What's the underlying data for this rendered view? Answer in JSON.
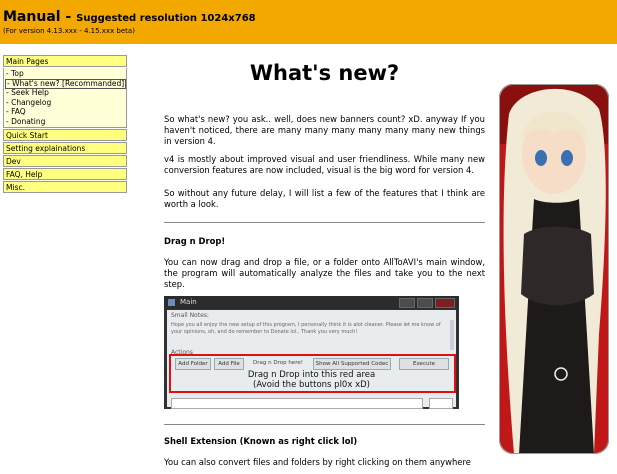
{
  "header": {
    "title": "Manual - ",
    "subtitle": "Suggested resolution 1024x768",
    "version": "(For version 4.13.xxx - 4.15.xxx beta)"
  },
  "sidebar": {
    "main_pages_label": "Main Pages",
    "items": [
      {
        "label": "- Top"
      },
      {
        "label": "- What's new? [Recommanded]"
      },
      {
        "label": "- Seek Help"
      },
      {
        "label": "- Changelog"
      },
      {
        "label": "- FAQ"
      },
      {
        "label": "- Donating"
      }
    ],
    "sections": [
      "Quick Start",
      "Setting explainations",
      "Dev",
      "FAQ, Help",
      "Misc."
    ]
  },
  "content": {
    "title": "What's new?",
    "p1": "So what's new? you ask.. well, does new banners count? xD. anyway If you haven't noticed, there are many many many many many many new things in version 4.",
    "p2": "v4 is mostly about improved visual and user friendliness. While many new conversion features are now included, visual is the big word for version 4.",
    "p3": "So without any future delay, I will list a few of the features that I think are worth a look.",
    "section1_title": "Drag n Drop!",
    "section1_text": "You can now drag and drop a file, or a folder onto AllToAVI's main window, the program will automatically analyze the files and take you to the next step.",
    "section2_title": "Shell Extension (Known as right click lol)",
    "section2_text": "You can also convert files and folders by right clicking on them anywhere"
  },
  "screenshot": {
    "window_title": "Main",
    "notes_label": "Small Notes:",
    "notes_text": "Hope you all enjoy the new setup of this program, I personally think it is alot cleaner. Please let me know of your opinions, oh, and do remember to Donate lol.. Thank you very much!",
    "actions_label": "Actions",
    "buttons": {
      "add_folder": "Add Folder",
      "add_file": "Add File",
      "drag_hint": "Drag n Drop here!",
      "show_codec": "Show All Supported Codec",
      "execute": "Execute"
    },
    "overlay_line1": "Drag n Drop into this red area",
    "overlay_line2": "(Avoid the buttons pl0x xD)"
  },
  "colors": {
    "banner": "#f3a800",
    "sidebar_section": "#ffff80",
    "red_area": "#e01010"
  }
}
